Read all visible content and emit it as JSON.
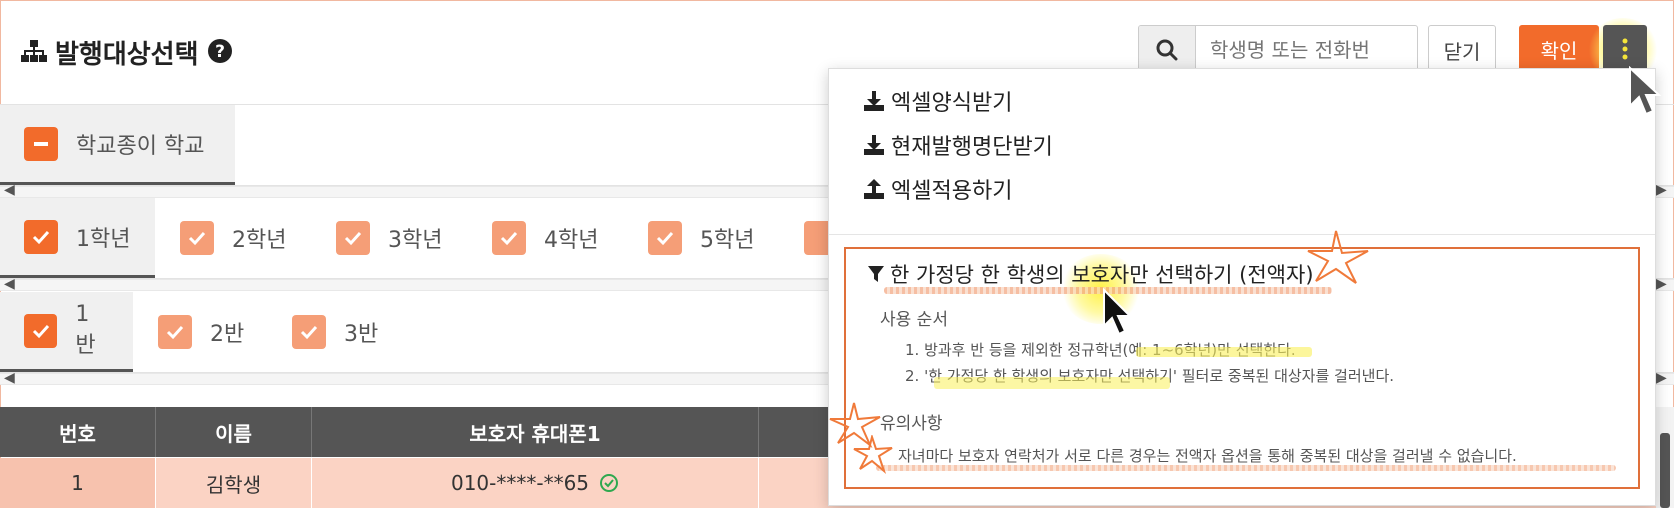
{
  "header": {
    "title": "발행대상선택",
    "search_placeholder": "학생명 또는 전화번",
    "close_label": "닫기",
    "confirm_label": "확인"
  },
  "school_row": {
    "label": "학교종이 학교"
  },
  "grades": [
    "1학년",
    "2학년",
    "3학년",
    "4학년",
    "5학년"
  ],
  "classes": [
    "1반",
    "2반",
    "3반"
  ],
  "table": {
    "headers": [
      "번호",
      "이름",
      "보호자 휴대폰1"
    ],
    "rows": [
      {
        "no": "1",
        "name": "김학생",
        "phone": "010-****-**65"
      }
    ]
  },
  "dropdown": {
    "items": [
      "엑셀양식받기",
      "현재발행명단받기",
      "엑셀적용하기"
    ],
    "notice": {
      "title": "한 가정당 한 학생의 보호자만 선택하기 (전액자)",
      "usage_title": "사용 순서",
      "steps": [
        "1. 방과후 반 등을 제외한 정규학년(예: 1~6학년)만 선택한다.",
        "2. '한 가정당 한 학생의 보호자만 선택하기' 필터로 중복된 대상자를 걸러낸다."
      ],
      "caution_title": "유의사항",
      "caution_text": "자녀마다 보호자 연락처가 서로 다른 경우는 전액자 옵션을 통해 중복된 대상을 걸러낼 수 없습니다."
    }
  },
  "colors": {
    "accent": "#f26b2b",
    "header_dark": "#555555",
    "row_highlight": "#fbd3c4",
    "annotation": "#e0703a"
  }
}
